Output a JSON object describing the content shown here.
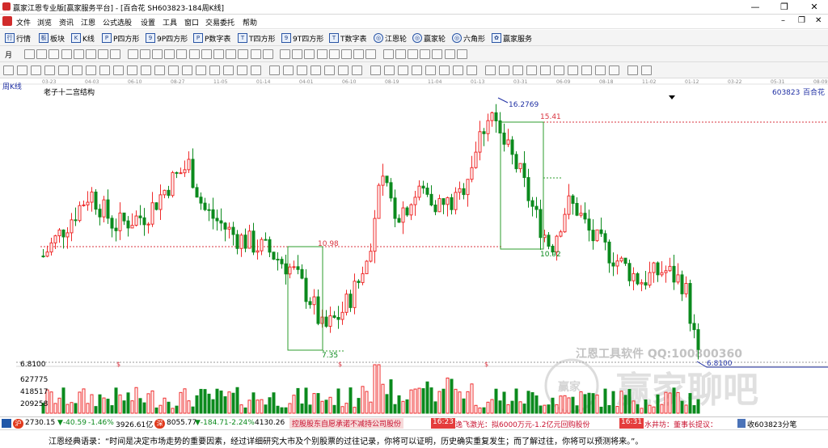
{
  "window": {
    "title": "赢家江恩专业版[赢家服务平台] - [百合花  SH603823-184周K线]",
    "minimize": "—",
    "restore": "❐",
    "close": "✕"
  },
  "mdi": {
    "minimize": "–",
    "restore": "❐",
    "close": "✕"
  },
  "menu": [
    "文件",
    "浏览",
    "资讯",
    "江恩",
    "公式选股",
    "设置",
    "工具",
    "窗口",
    "交易委托",
    "帮助"
  ],
  "toolbar1": [
    {
      "icon": "行",
      "label": "行情"
    },
    {
      "icon": "板",
      "label": "板块"
    },
    {
      "icon": "K",
      "label": "K线"
    },
    {
      "icon": "P",
      "label": "P四方形"
    },
    {
      "icon": "9",
      "label": "9P四方形"
    },
    {
      "icon": "P",
      "label": "P数字表"
    },
    {
      "icon": "T",
      "label": "T四方形"
    },
    {
      "icon": "9",
      "label": "9T四方形"
    },
    {
      "icon": "T",
      "label": "T数字表"
    },
    {
      "icon": "◎",
      "label": "江恩轮"
    },
    {
      "icon": "◎",
      "label": "赢家轮"
    },
    {
      "icon": "◎",
      "label": "六角形"
    },
    {
      "icon": "✿",
      "label": "赢家服务"
    }
  ],
  "toolbar2_first": "月",
  "chart": {
    "period_label": "周K线",
    "indicator_label": "老子十二宫结构",
    "code": "603823",
    "name": "百合花",
    "dates": [
      "03-23",
      "04-03",
      "06-10",
      "08-27",
      "11-05",
      "01-14",
      "04-01",
      "06-10",
      "08-19",
      "11-04",
      "01-13",
      "03-31",
      "06-09",
      "08-18",
      "11-02",
      "01-12",
      "03-22",
      "05-31",
      "08-09"
    ],
    "price_labels": [
      "16.2769",
      "15.41",
      "10.98",
      "10.92",
      "7.35",
      "6.8100"
    ],
    "axis_value": "6.8100",
    "dollar_marks": [
      "$",
      "$",
      "$"
    ],
    "volume_ticks": [
      "627775",
      "418517",
      "209258"
    ],
    "watermark_tool": "江恩工具软件  QQ:100800360",
    "watermark_brand": "赢家聊吧",
    "watermark_logo_text": "赢家"
  },
  "chart_data": {
    "type": "candlestick",
    "title": "百合花 603823 周K线",
    "x_ticks": [
      "03-23",
      "04-03",
      "06-10",
      "08-27",
      "11-05",
      "01-14",
      "04-01",
      "06-10",
      "08-19",
      "11-04",
      "01-13",
      "03-31",
      "06-09",
      "08-18",
      "11-02",
      "01-12",
      "03-22",
      "05-31",
      "08-09"
    ],
    "annotated_prices": [
      16.2769,
      15.41,
      10.98,
      10.92,
      7.35,
      6.81
    ],
    "ylim": [
      6.5,
      17
    ],
    "volume_ticks": [
      627775,
      418517,
      209258
    ]
  },
  "status": {
    "sh_icon": "沪",
    "sh_index": "2730.15",
    "sh_change": "▼-40.59",
    "sh_pct": "-1.46%",
    "sh_amount": "3926.61亿",
    "sz_icon": "深",
    "sz_index": "8055.77",
    "sz_change": "▼-184.71",
    "sz_pct": "-2.24%",
    "sz_amount": "4130.26",
    "news1": "控股股东自愿承诺不减持公司股份",
    "news1_time": "16:23",
    "news2": "逸飞激光：拟6000万元-1.2亿元回购股份",
    "news2_time": "16:31",
    "news3": "水井坊：董事长提议：",
    "inbox": "收603823分笔"
  },
  "quote": "江恩经典语录：“时间是决定市场走势的重要因素，经过详细研究大市及个别股票的过往记录，你将可以证明，历史确实重复发生；而了解过往，你将可以预测将来。”。",
  "colors": {
    "up": "#ef2b2b",
    "down": "#0b8a1d",
    "box": "#2e9e2e",
    "level": "#d9333f",
    "accent": "#1f2fa3"
  }
}
